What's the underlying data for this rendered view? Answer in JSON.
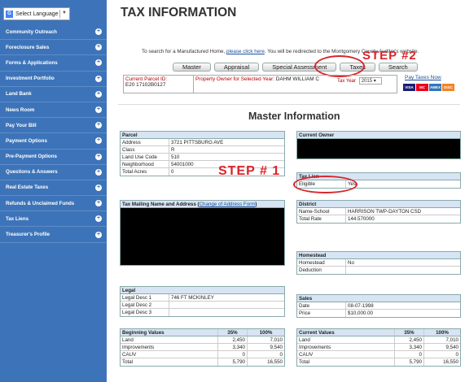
{
  "sidebar": {
    "language_label": "Select Language",
    "items": [
      {
        "label": "Community Outreach"
      },
      {
        "label": "Foreclosure Sales"
      },
      {
        "label": "Forms & Applications"
      },
      {
        "label": "Investment Portfolio"
      },
      {
        "label": "Land Bank"
      },
      {
        "label": "News Room"
      },
      {
        "label": "Pay Your Bill"
      },
      {
        "label": "Payment Options"
      },
      {
        "label": "Pre-Payment Options"
      },
      {
        "label": "Questions & Answers"
      },
      {
        "label": "Real Estate Taxes"
      },
      {
        "label": "Refunds & Unclaimed Funds"
      },
      {
        "label": "Tax Liens"
      },
      {
        "label": "Treasurer's Profile"
      }
    ]
  },
  "header": {
    "title": "TAX INFORMATION"
  },
  "search_text": {
    "before": "To search for a Manufactured Home, ",
    "link": "please click here",
    "after": ". You will be redirected to the Montgomery County Auditor's website."
  },
  "tabs": [
    "Master",
    "Appraisal",
    "Special Assessment",
    "Taxes",
    "Search"
  ],
  "parcel_strip": {
    "parcel_label": "Current Parcel ID:",
    "parcel_value": "E20 17102B0127",
    "owner_label": "Property Owner for Selected Year:",
    "owner_value": "DAHM WILLIAM C",
    "tax_year_label": "Tax Year",
    "tax_year_value": "2015"
  },
  "pay_taxes_link": "Pay Taxes Now",
  "cards": [
    "VISA",
    "MC",
    "AMEX",
    "DISC"
  ],
  "annotations": {
    "step1": "STEP # 1",
    "step2": "STEP #2"
  },
  "section_title": "Master Information",
  "parcel": {
    "header": "Parcel",
    "rows": [
      {
        "k": "Address",
        "v": "3721 PITTSBURG AVE"
      },
      {
        "k": "Class",
        "v": "R"
      },
      {
        "k": "Land Use Code",
        "v": "510"
      },
      {
        "k": "Neighborhood",
        "v": "54001000"
      },
      {
        "k": "Total Acres",
        "v": "0"
      }
    ]
  },
  "current_owner": {
    "header": "Current Owner"
  },
  "tax_lien": {
    "header": "Tax Lien",
    "k": "Eligible",
    "v": "Yes"
  },
  "mailing": {
    "header": "Tax Mailing Name and Address",
    "link": "Change of Address Form"
  },
  "district": {
    "header": "District",
    "rows": [
      {
        "k": "Name-School",
        "v": "HARRISON TWP-DAYTON CSD"
      },
      {
        "k": "Total Rate",
        "v": "144.570000"
      }
    ]
  },
  "homestead": {
    "header": "Homestead",
    "rows": [
      {
        "k": "Homestead",
        "v": "No"
      },
      {
        "k": "Deduction",
        "v": ""
      }
    ]
  },
  "legal": {
    "header": "Legal",
    "rows": [
      {
        "k": "Legal Desc 1",
        "v": "746 FT MCKINLEY"
      },
      {
        "k": "Legal Desc 2",
        "v": ""
      },
      {
        "k": "Legal Desc 3",
        "v": ""
      }
    ]
  },
  "sales": {
    "header": "Sales",
    "rows": [
      {
        "k": "Date",
        "v": "08-07-1998"
      },
      {
        "k": "Price",
        "v": "$10,000.00"
      }
    ]
  },
  "beginning_values": {
    "header": [
      "Beginning Values",
      "35%",
      "100%"
    ],
    "rows": [
      [
        "Land",
        "2,450",
        "7,010"
      ],
      [
        "Improvements",
        "3,340",
        "9,540"
      ],
      [
        "CAUV",
        "0",
        "0"
      ],
      [
        "Total",
        "5,790",
        "16,550"
      ]
    ]
  },
  "current_values": {
    "header": [
      "Current Values",
      "35%",
      "100%"
    ],
    "rows": [
      [
        "Land",
        "2,450",
        "7,010"
      ],
      [
        "Improvements",
        "3,340",
        "9,540"
      ],
      [
        "CAUV",
        "0",
        "0"
      ],
      [
        "Total",
        "5,790",
        "16,550"
      ]
    ]
  },
  "colors": {
    "sidebar": "#3d74b9",
    "annotation": "#d9252b",
    "table_header": "#d7e4f3",
    "label_red": "#b30000"
  }
}
